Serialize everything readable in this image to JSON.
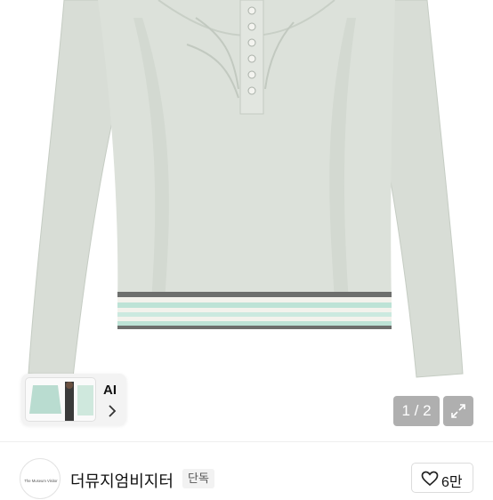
{
  "product": {
    "image_alt": "mint grey long-sleeve ribbed henley top with ruched button placket and striped hem",
    "colors": {
      "garment": "#dadfd8",
      "garment_shade": "#c7cec5",
      "stripe_dark": "#6d6f6d",
      "stripe_mint": "#bde3d6",
      "stripe_cream": "#f3f2ec"
    }
  },
  "ai_card": {
    "label": "AI",
    "chevron_icon": "chevron-right-icon"
  },
  "gallery": {
    "counter": "1 / 2",
    "expand_icon": "expand-arrows-icon"
  },
  "seller": {
    "logo_text": "The Museum Visitor",
    "name": "더뮤지엄비지터",
    "badge": "단독"
  },
  "like": {
    "icon": "heart-outline-icon",
    "count": "6만"
  }
}
